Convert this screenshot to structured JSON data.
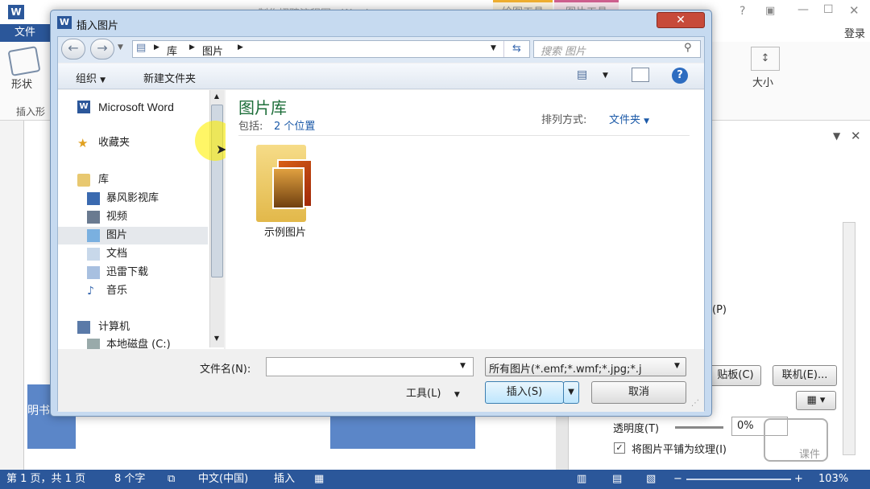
{
  "word": {
    "title_fragment": "制作招聘流程图 - Word",
    "context_tab_1": "绘图工具",
    "context_tab_2": "图片工具",
    "file_tab": "文件",
    "login": "登录",
    "ribbon_shape": "形状",
    "ribbon_insert_group": "插入形",
    "ribbon_size": "大小",
    "pane_p": "(P)",
    "pane_clipboard": "贴板(C)",
    "pane_online": "联机(E)...",
    "transparency_label": "透明度(T)",
    "transparency_value": "0%",
    "tile_checkbox": "将图片平铺为纹理(I)",
    "doc_text": "明书",
    "watermark": "课件"
  },
  "status": {
    "page": "第 1 页，共 1 页",
    "words": "8 个字",
    "lang": "中文(中国)",
    "mode": "插入",
    "zoom": "103%"
  },
  "dialog": {
    "title": "插入图片",
    "close": "✕",
    "breadcrumb": [
      "库",
      "图片"
    ],
    "search_placeholder": "搜索 图片",
    "organize": "组织",
    "new_folder": "新建文件夹",
    "nav": {
      "top": "Microsoft Word",
      "favorites": "收藏夹",
      "libraries": "库",
      "lib_items": [
        "暴风影视库",
        "视频",
        "图片",
        "文档",
        "迅雷下载",
        "音乐"
      ],
      "computer": "计算机",
      "drive": "本地磁盘 (C:)"
    },
    "library_title": "图片库",
    "includes_label": "包括:",
    "includes_value": "2 个位置",
    "arrange_label": "排列方式:",
    "arrange_value": "文件夹",
    "folder_name": "示例图片",
    "filename_label": "文件名(N):",
    "filename_value": "",
    "filetype_value": "所有图片(*.emf;*.wmf;*.jpg;*.j",
    "tools": "工具(L)",
    "insert": "插入(S)",
    "cancel": "取消"
  }
}
